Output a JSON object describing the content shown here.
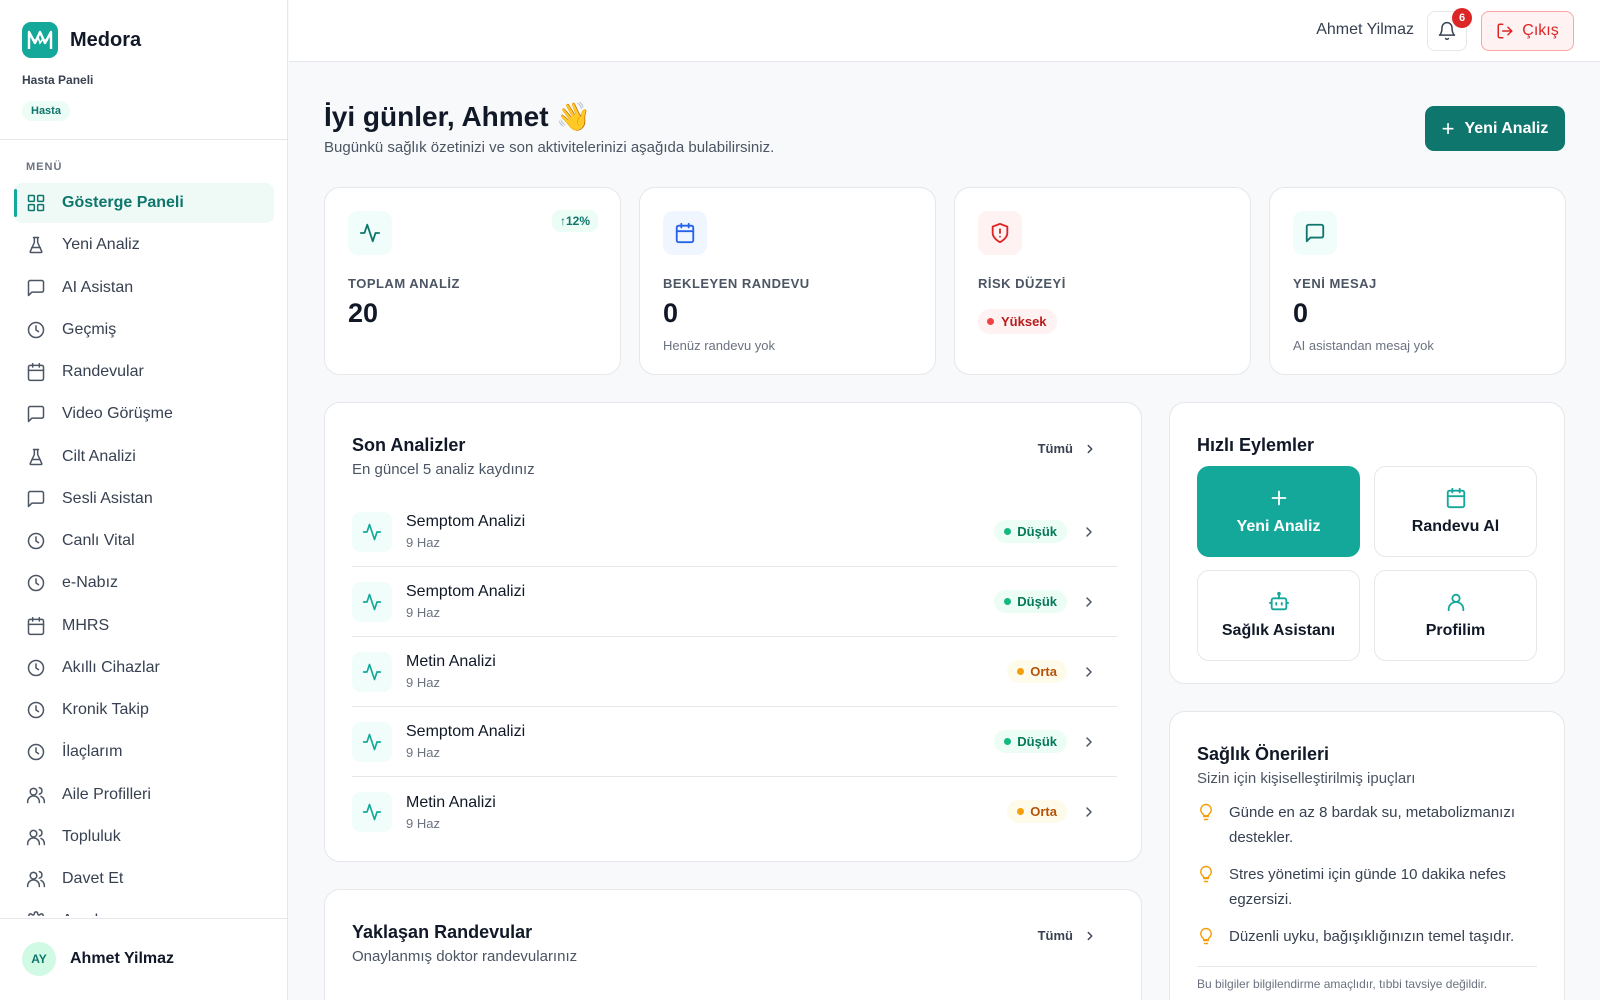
{
  "app": {
    "name": "Medora",
    "panel_label": "Hasta Paneli",
    "role": "Hasta"
  },
  "sidebar": {
    "menu_label": "MENÜ",
    "items": [
      {
        "label": "Gösterge Paneli",
        "icon": "grid-icon",
        "active": true
      },
      {
        "label": "Yeni Analiz",
        "icon": "flask-icon"
      },
      {
        "label": "AI Asistan",
        "icon": "chat-icon"
      },
      {
        "label": "Geçmiş",
        "icon": "clock-icon"
      },
      {
        "label": "Randevular",
        "icon": "calendar-icon"
      },
      {
        "label": "Video Görüşme",
        "icon": "chat-icon"
      },
      {
        "label": "Cilt Analizi",
        "icon": "flask-icon"
      },
      {
        "label": "Sesli Asistan",
        "icon": "chat-icon"
      },
      {
        "label": "Canlı Vital",
        "icon": "clock-icon"
      },
      {
        "label": "e-Nabız",
        "icon": "clock-icon"
      },
      {
        "label": "MHRS",
        "icon": "calendar-icon"
      },
      {
        "label": "Akıllı Cihazlar",
        "icon": "clock-icon"
      },
      {
        "label": "Kronik Takip",
        "icon": "clock-icon"
      },
      {
        "label": "İlaçlarım",
        "icon": "clock-icon"
      },
      {
        "label": "Aile Profilleri",
        "icon": "users-icon"
      },
      {
        "label": "Topluluk",
        "icon": "users-icon"
      },
      {
        "label": "Davet Et",
        "icon": "users-icon"
      },
      {
        "label": "Ayarlar",
        "icon": "gear-icon"
      }
    ],
    "user": {
      "initials": "AY",
      "name": "Ahmet Yilmaz"
    }
  },
  "topbar": {
    "user_name": "Ahmet Yilmaz",
    "notification_count": "6",
    "logout_label": "Çıkış"
  },
  "header": {
    "greeting": "İyi günler, Ahmet 👋",
    "subtitle": "Bugünkü sağlık özetinizi ve son aktivitelerinizi aşağıda bulabilirsiniz.",
    "new_analysis_label": "Yeni Analiz"
  },
  "stats": {
    "total": {
      "label": "TOPLAM ANALİZ",
      "value": "20",
      "trend": "↑12%"
    },
    "appointments": {
      "label": "BEKLEYEN RANDEVU",
      "value": "0",
      "sub": "Henüz randevu yok"
    },
    "risk": {
      "label": "RİSK DÜZEYİ",
      "value": "Yüksek"
    },
    "messages": {
      "label": "YENİ MESAJ",
      "value": "0",
      "sub": "AI asistandan mesaj yok"
    }
  },
  "recent": {
    "title": "Son Analizler",
    "subtitle": "En güncel 5 analiz kaydınız",
    "all_label": "Tümü",
    "rows": [
      {
        "title": "Semptom Analizi",
        "date": "9 Haz",
        "level": "Düşük",
        "kind": "low"
      },
      {
        "title": "Semptom Analizi",
        "date": "9 Haz",
        "level": "Düşük",
        "kind": "low"
      },
      {
        "title": "Metin Analizi",
        "date": "9 Haz",
        "level": "Orta",
        "kind": "mid"
      },
      {
        "title": "Semptom Analizi",
        "date": "9 Haz",
        "level": "Düşük",
        "kind": "low"
      },
      {
        "title": "Metin Analizi",
        "date": "9 Haz",
        "level": "Orta",
        "kind": "mid"
      }
    ]
  },
  "quick": {
    "title": "Hızlı Eylemler",
    "actions": [
      {
        "label": "Yeni Analiz",
        "icon": "plus-icon"
      },
      {
        "label": "Randevu Al",
        "icon": "calendar-icon"
      },
      {
        "label": "Sağlık Asistanı",
        "icon": "robot-icon"
      },
      {
        "label": "Profilim",
        "icon": "user-icon"
      }
    ]
  },
  "upcoming": {
    "title": "Yaklaşan Randevular",
    "subtitle": "Onaylanmış doktor randevularınız",
    "all_label": "Tümü"
  },
  "tips": {
    "title": "Sağlık Önerileri",
    "subtitle": "Sizin için kişiselleştirilmiş ipuçları",
    "items": [
      "Günde en az 8 bardak su, metabolizmanızı destekler.",
      "Stres yönetimi için günde 10 dakika nefes egzersizi.",
      "Düzenli uyku, bağışıklığınızın temel taşıdır."
    ],
    "disclaimer": "Bu bilgiler bilgilendirme amaçlıdır, tıbbi tavsiye değildir."
  },
  "colors": {
    "accent": "#14a89a",
    "accent_dark": "#0f766e",
    "danger": "#dc2626",
    "warning": "#f59e0b",
    "success": "#10b981"
  }
}
